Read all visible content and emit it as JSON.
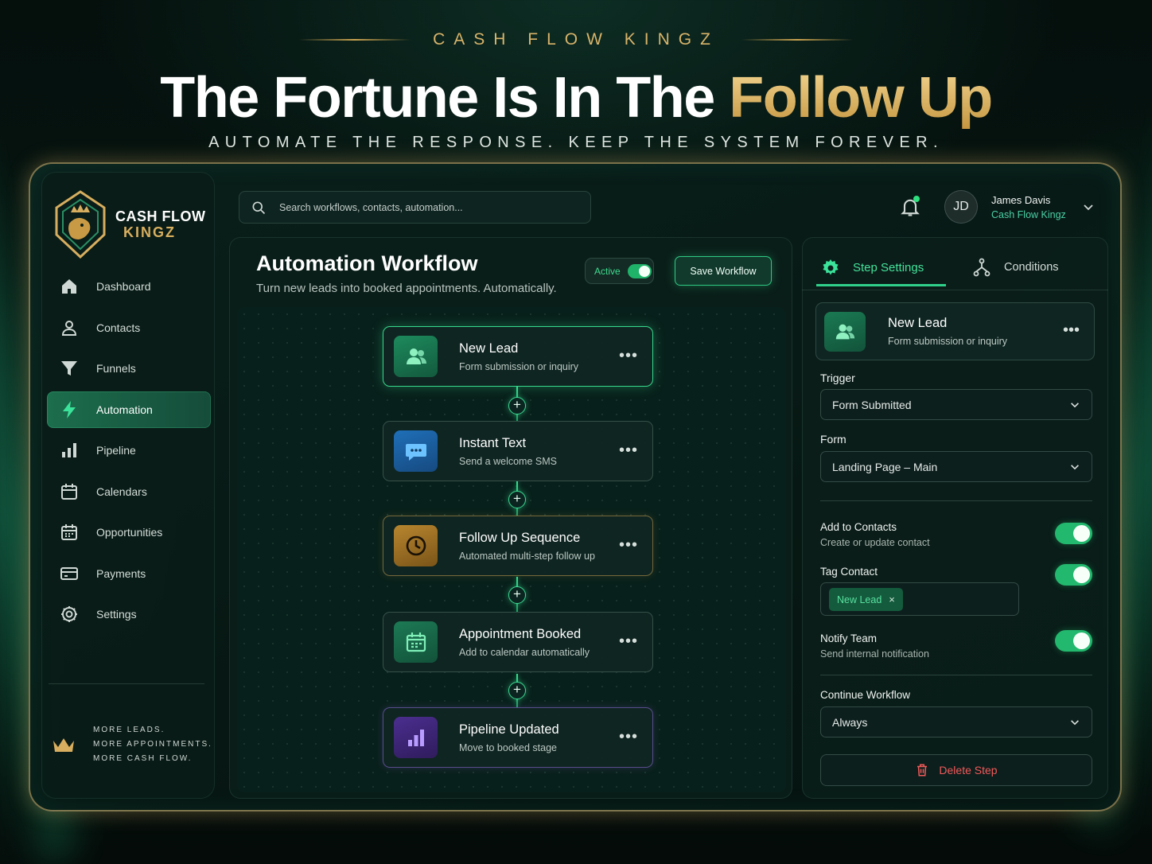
{
  "hero": {
    "brand": "CASH FLOW KINGZ",
    "headline_white": "The Fortune Is In The ",
    "headline_gold": "Follow Up",
    "subheadline": "AUTOMATE THE RESPONSE. KEEP THE SYSTEM FOREVER."
  },
  "sidebar": {
    "logo_line1": "CASH FLOW",
    "logo_line2": "KINGZ",
    "items": [
      {
        "label": "Dashboard",
        "icon": "home-icon",
        "active": false
      },
      {
        "label": "Contacts",
        "icon": "user-icon",
        "active": false
      },
      {
        "label": "Funnels",
        "icon": "funnel-icon",
        "active": false
      },
      {
        "label": "Automation",
        "icon": "lightning-icon",
        "active": true
      },
      {
        "label": "Pipeline",
        "icon": "bar-chart-icon",
        "active": false
      },
      {
        "label": "Calendars",
        "icon": "calendar-icon",
        "active": false
      },
      {
        "label": "Opportunities",
        "icon": "calendar-grid-icon",
        "active": false
      },
      {
        "label": "Payments",
        "icon": "credit-card-icon",
        "active": false
      },
      {
        "label": "Settings",
        "icon": "gear-icon",
        "active": false
      }
    ],
    "tagline": [
      "MORE LEADS.",
      "MORE APPOINTMENTS.",
      "MORE CASH FLOW."
    ]
  },
  "topbar": {
    "search_placeholder": "Search workflows, contacts, automation...",
    "user_initials": "JD",
    "user_name": "James Davis",
    "user_company": "Cash Flow Kingz"
  },
  "workflow": {
    "title": "Automation Workflow",
    "subtitle": "Turn new leads into booked appointments. Automatically.",
    "status_label": "Active",
    "status_on": true,
    "save_label": "Save Workflow",
    "nodes": [
      {
        "title": "New Lead",
        "subtitle": "Form submission or inquiry",
        "icon": "users-icon",
        "accent": "#1d8a5c"
      },
      {
        "title": "Instant Text",
        "subtitle": "Send a welcome SMS",
        "icon": "chat-bubble-icon",
        "accent": "#1f6fb8"
      },
      {
        "title": "Follow Up Sequence",
        "subtitle": "Automated multi-step follow up",
        "icon": "clock-icon",
        "accent": "#b8862f"
      },
      {
        "title": "Appointment Booked",
        "subtitle": "Add to calendar automatically",
        "icon": "calendar-icon",
        "accent": "#1d8a5c"
      },
      {
        "title": "Pipeline Updated",
        "subtitle": "Move to booked stage",
        "icon": "bar-chart-icon",
        "accent": "#6a3fc4"
      }
    ],
    "add_step_symbol": "+",
    "more_symbol": "•••"
  },
  "step_settings": {
    "tab_active": "Step Settings",
    "tab_other": "Conditions",
    "step_title": "New Lead",
    "step_subtitle": "Form submission or inquiry",
    "trigger_label": "Trigger",
    "trigger_value": "Form Submitted",
    "form_label": "Form",
    "form_value": "Landing Page – Main",
    "add_contacts_label": "Add to Contacts",
    "add_contacts_sub": "Create or update contact",
    "add_contacts_on": true,
    "tag_contact_label": "Tag Contact",
    "tag_contact_on": true,
    "tag_chip": "New Lead",
    "tag_chip_remove": "×",
    "notify_label": "Notify Team",
    "notify_sub": "Send internal notification",
    "notify_on": true,
    "continue_label": "Continue Workflow",
    "continue_value": "Always",
    "delete_label": "Delete Step"
  },
  "colors": {
    "accent_green": "#2fd08a",
    "gold": "#d9b46a",
    "danger": "#f05a5a",
    "background": "#061410"
  }
}
